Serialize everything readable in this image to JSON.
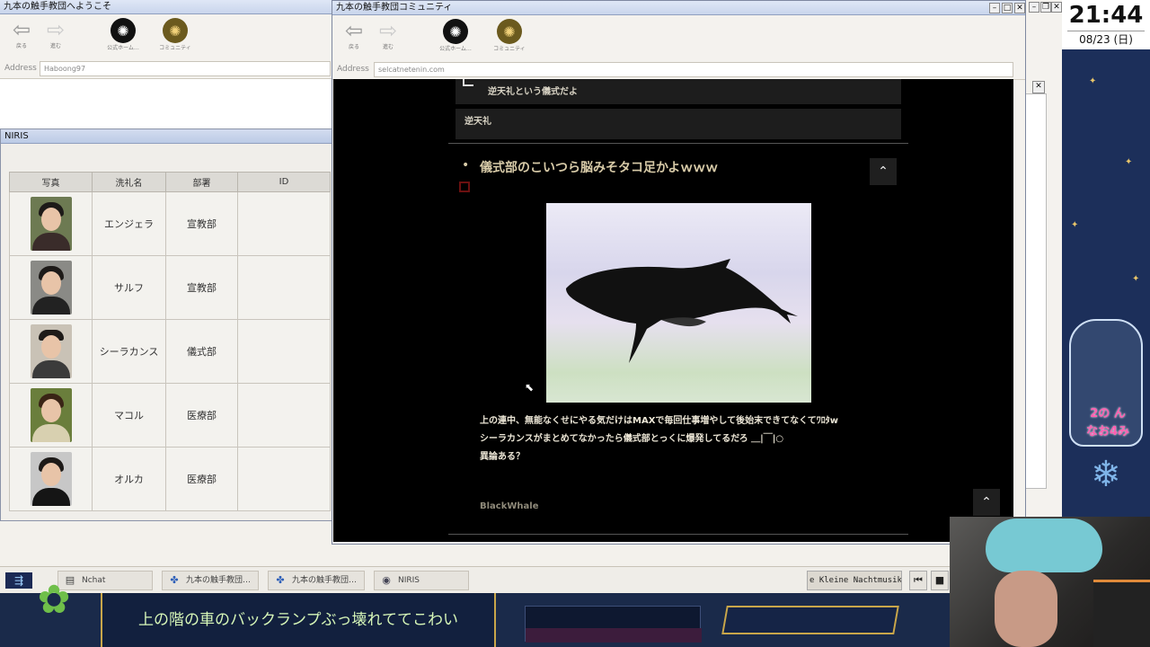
{
  "welcome_window": {
    "title": "九本の触手教団へようこそ",
    "nav": {
      "back": "戻る",
      "forward": "進む",
      "official_home": "公式ホーム…",
      "community": "コミュニティ"
    },
    "address_label": "Address",
    "address_value": "Haboong97"
  },
  "niris_window": {
    "title": "NIRIS",
    "columns": [
      "写真",
      "洗礼名",
      "部署",
      "ID"
    ],
    "rows": [
      {
        "name": "エンジェラ",
        "dept": "宣教部",
        "id": ""
      },
      {
        "name": "サルフ",
        "dept": "宣教部",
        "id": ""
      },
      {
        "name": "シーラカンス",
        "dept": "儀式部",
        "id": ""
      },
      {
        "name": "マコル",
        "dept": "医療部",
        "id": ""
      },
      {
        "name": "オルカ",
        "dept": "医療部",
        "id": ""
      }
    ]
  },
  "community_window": {
    "title": "九本の触手教団コミュニティ",
    "nav": {
      "back": "戻る",
      "forward": "進む",
      "official_home": "公式ホーム…",
      "community": "コミュニティ"
    },
    "address_label": "Address",
    "address_value": "selcatnetenin.com",
    "replies": [
      "逆天礼という儀式だよ",
      "逆天礼"
    ],
    "post": {
      "bullet": "•",
      "title": "儀式部のこいつら脳みそタコ足かよｗｗｗ",
      "body": [
        "上の連中、無能なくせにやる気だけはMAXで毎回仕事増やして後始末できてなくてﾜﾛﾀw",
        "シーラカンスがまとめてなかったら儀式部とっくに爆発してるだろ ＿|￣|○",
        "異論ある？"
      ],
      "author": "BlackWhale"
    }
  },
  "taskbar": {
    "items": [
      "Nchat",
      "九本の触手教団…",
      "九本の触手教団…",
      "NIRIS"
    ],
    "music": "e Kleine Nachtmusik _"
  },
  "clock": {
    "time": "21:44",
    "date": "08/23 (日)"
  },
  "overlay": {
    "subtitle": "上の階の車のバックランプぶっ壊れててこわい",
    "badge_top": "2の ん",
    "badge_bottom": "なお4み"
  },
  "colors": {
    "accent_gold": "#c9a64a",
    "overlay_navy": "#1c2f5a",
    "post_title": "#d8cba8"
  }
}
